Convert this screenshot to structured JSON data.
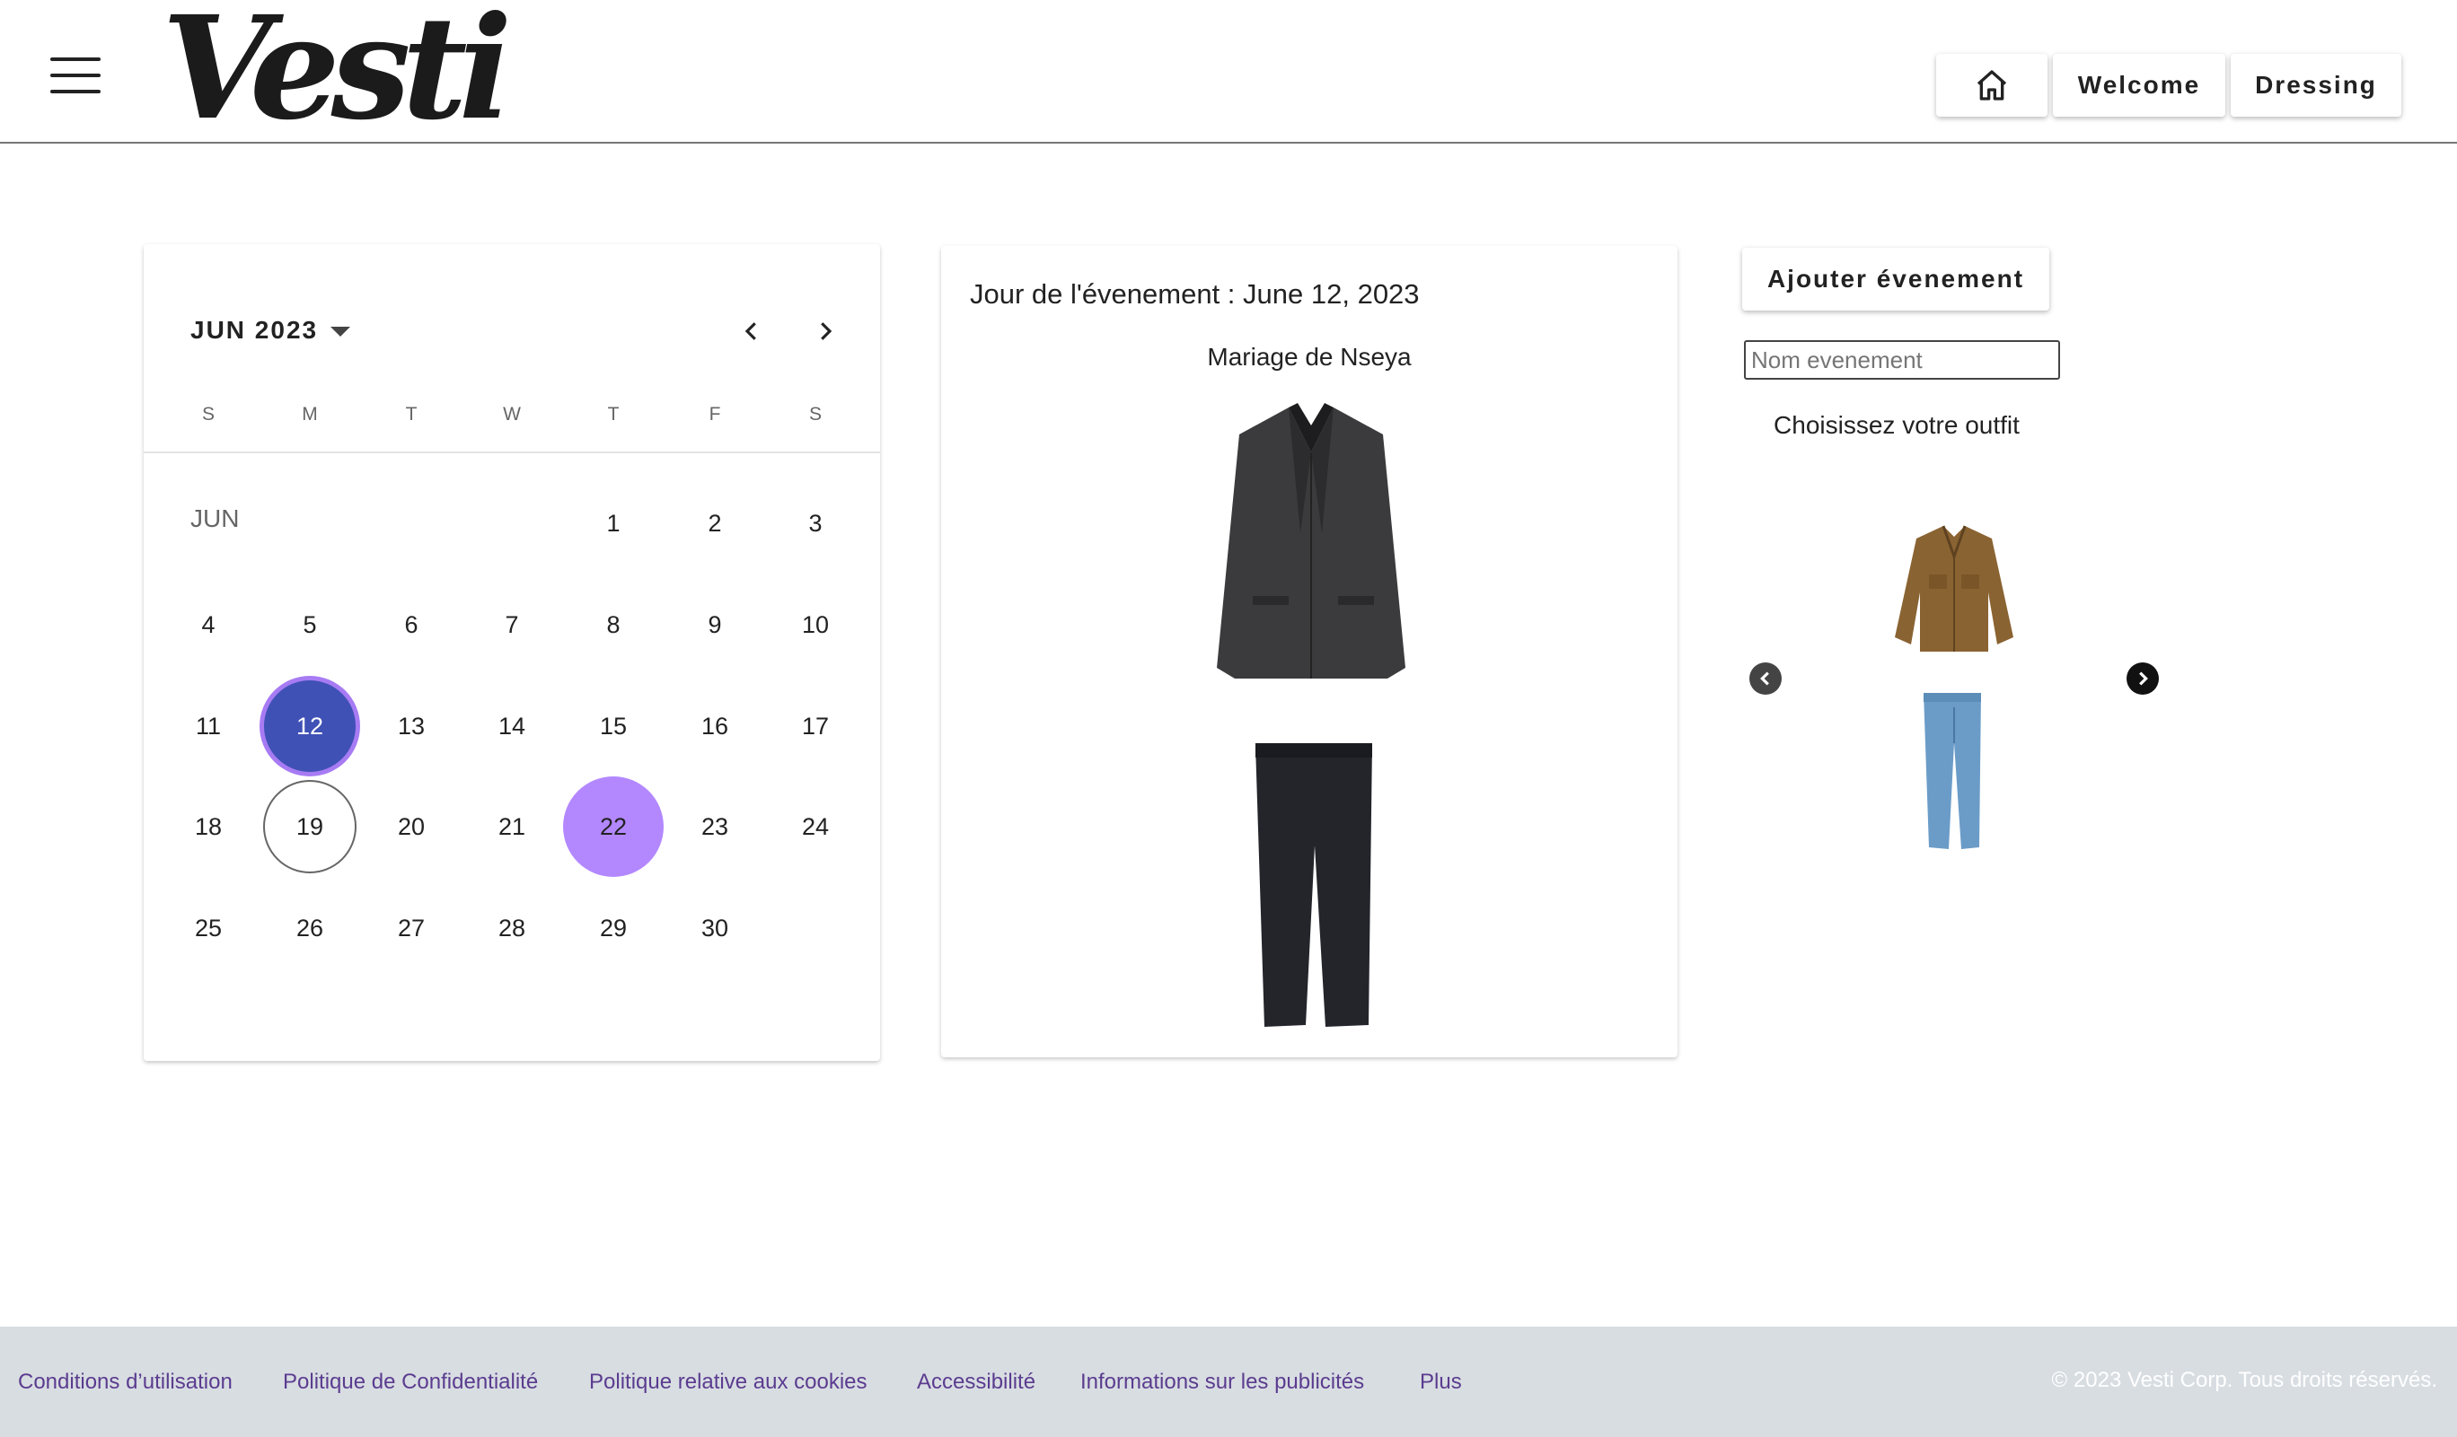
{
  "header": {
    "logo": "Vesti",
    "nav": {
      "home_icon": "home-icon",
      "welcome": "Welcome",
      "dressing": "Dressing"
    }
  },
  "calendar": {
    "title": "JUN 2023",
    "weekdays": [
      "S",
      "M",
      "T",
      "W",
      "T",
      "F",
      "S"
    ],
    "month_label": "JUN",
    "days": [
      "1",
      "2",
      "3",
      "4",
      "5",
      "6",
      "7",
      "8",
      "9",
      "10",
      "11",
      "12",
      "13",
      "14",
      "15",
      "16",
      "17",
      "18",
      "19",
      "20",
      "21",
      "22",
      "23",
      "24",
      "25",
      "26",
      "27",
      "28",
      "29",
      "30"
    ],
    "selected_day": "12",
    "today": "19",
    "highlighted_day": "22",
    "colors": {
      "selected": "#3f51b5",
      "selected_ring": "#a77bf3",
      "highlight": "#b388ff"
    }
  },
  "event": {
    "title": "Jour de l'évenement : June 12, 2023",
    "name": "Mariage de Nseya",
    "items": [
      "suit-jacket",
      "suit-trousers"
    ]
  },
  "panel": {
    "add_event": "Ajouter évenement",
    "input_placeholder": "Nom evenement",
    "choose_outfit": "Choisissez votre outfit",
    "carousel_items": [
      "corduroy-jacket",
      "denim-jeans"
    ]
  },
  "footer": {
    "links": [
      "Conditions d’utilisation",
      "Politique de Confidentialité",
      "Politique relative aux cookies",
      "Accessibilité",
      "Informations sur les publicités",
      "Plus"
    ],
    "copyright": "© 2023 Vesti Corp. Tous droits réservés."
  }
}
